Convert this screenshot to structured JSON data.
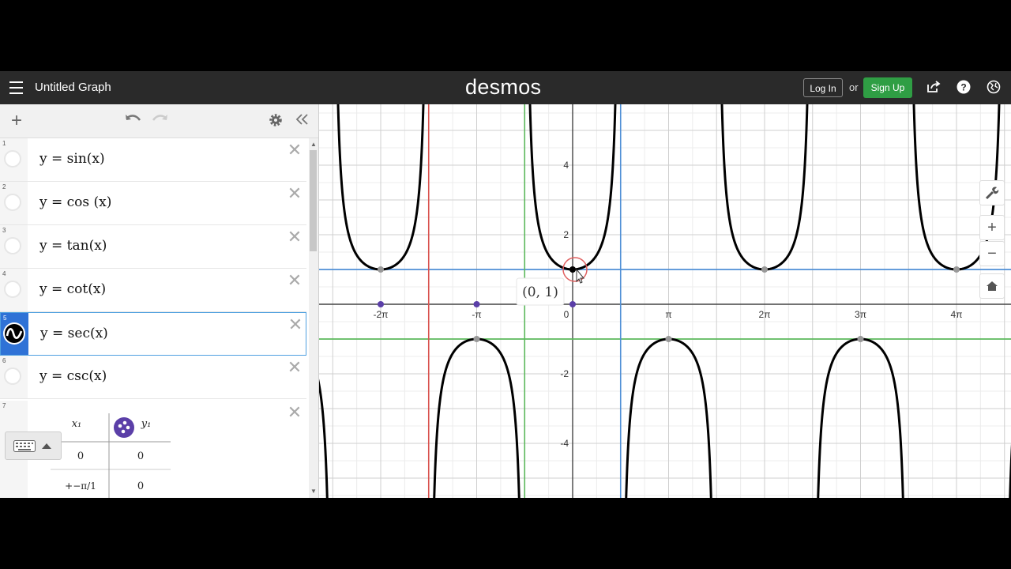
{
  "header": {
    "graph_title": "Untitled Graph",
    "logo": "desmos",
    "login_label": "Log In",
    "or_text": "or",
    "signup_label": "Sign Up"
  },
  "expressions": [
    {
      "num": "1",
      "text": "y = sin(x)"
    },
    {
      "num": "2",
      "text": "y = cos (x)"
    },
    {
      "num": "3",
      "text": "y = tan(x)"
    },
    {
      "num": "4",
      "text": "y = cot(x)"
    },
    {
      "num": "5",
      "text": "y = sec(x)",
      "selected": true
    },
    {
      "num": "6",
      "text": "y = csc(x)"
    }
  ],
  "table": {
    "num": "7",
    "col_x": "x₁",
    "col_y": "y₁",
    "rows": [
      {
        "x": "0",
        "y": "0"
      },
      {
        "x": "+−π/1",
        "y": "0"
      }
    ]
  },
  "graph": {
    "x_tick_labels": [
      "-2π",
      "-π",
      "0",
      "π",
      "2π",
      "3π",
      "4π"
    ],
    "y_tick_labels": [
      "4",
      "2",
      "-2",
      "-4"
    ],
    "point_label": "(0, 1)",
    "line_color": "#000000",
    "horizontal_line_blue": "#4f8fd6",
    "horizontal_line_green": "#5cb85c",
    "vertical_line_red": "#d9534f",
    "vertical_line_green": "#5cb85c",
    "vertical_line_blue": "#4f8fd6",
    "point_color": "#5b3fa8"
  },
  "icons": {
    "menu": "hamburger-icon",
    "share": "share-icon",
    "help": "help-icon",
    "language": "globe-icon",
    "add": "plus-icon",
    "undo": "undo-icon",
    "redo": "redo-icon",
    "settings": "gear-icon",
    "collapse": "double-chevron-left-icon",
    "wrench": "wrench-icon",
    "zoom_in": "zoom-in-icon",
    "zoom_out": "zoom-out-icon",
    "home": "home-icon",
    "keyboard": "keyboard-icon"
  }
}
